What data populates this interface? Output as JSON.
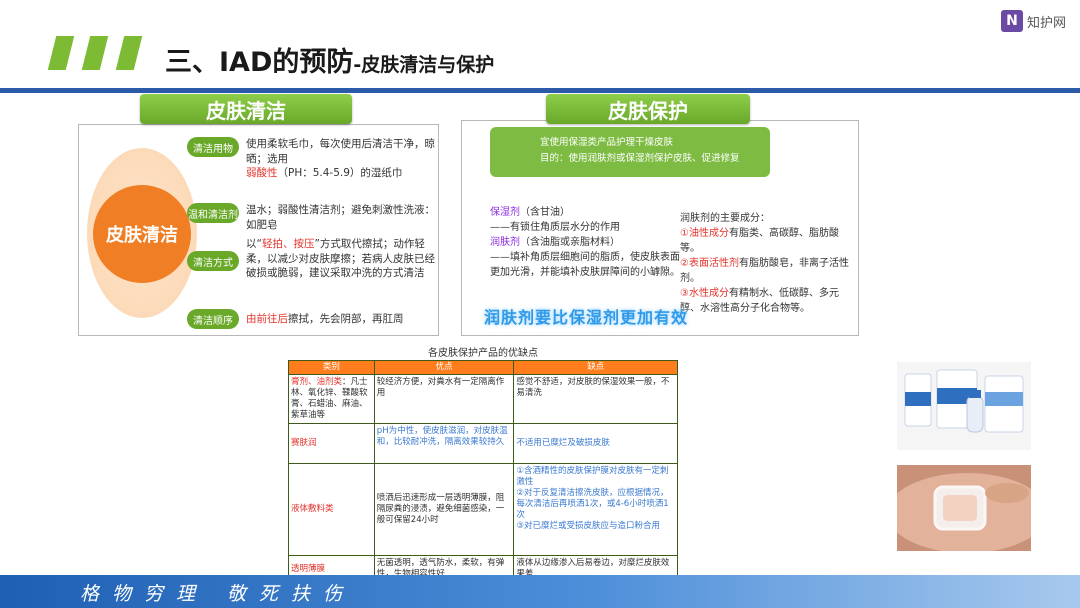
{
  "header": {
    "title_main": "三、IAD的预防",
    "title_sub": "-皮肤清洁与保护",
    "watermark_text": "知护网",
    "watermark_logo": "N"
  },
  "cleaning": {
    "tag": "皮肤清洁",
    "center": "皮肤清洁",
    "rows": [
      {
        "pill": "清洁用物",
        "text": "使用柔软毛巾，每次使用后清洁干净，晾晒；选用",
        "text_red": "弱酸性",
        "text_tail": "（PH：5.4-5.9）的湿纸巾"
      },
      {
        "pill": "温和清洁剂",
        "text": "温水；弱酸性清洁剂；避免刺激性洗液：如肥皂"
      },
      {
        "pill": "清洁方式",
        "text_pre": "以“",
        "text_red": "轻拍、按压",
        "text": "”方式取代擦拭；动作轻柔，以减少对皮肤摩擦；若病人皮肤已经破损或脆弱，建议采取冲洗的方式清洁"
      },
      {
        "pill": "清洁顺序",
        "text_red": "由前往后",
        "text": "擦拭，先会阴部，再肛周"
      }
    ]
  },
  "protection": {
    "tag": "皮肤保护",
    "goal_line1": "宜使用保湿类产品护理干燥皮肤",
    "goal_line2": "目的：使用润肤剂或保湿剂保护皮肤、促进修复",
    "moisturizer_label": "保湿剂",
    "moisturizer_note": "（含甘油）",
    "moisturizer_desc": "——有锁住角质层水分的作用",
    "emollient_label": "润肤剂",
    "emollient_note": "（含油脂或亲脂材料）",
    "emollient_desc": "——填补角质层细胞间的脂质，使皮肤表面更加光滑，并能填补皮肤屏障间的小罅隙。",
    "components_title": "润肤剂的主要成分：",
    "components": [
      {
        "num": "①",
        "red": "油性成分",
        "text": "有脂类、高碳醇、脂肪酸等。"
      },
      {
        "num": "②",
        "red": "表面活性剂",
        "text": "有脂肪酸皂，非离子活性剂。"
      },
      {
        "num": "③",
        "red": "水性成分",
        "text": "有精制水、低碳醇、多元醇、水溶性高分子化合物等。"
      }
    ],
    "slogan": "润肤剂要比保湿剂更加有效"
  },
  "table": {
    "title": "各皮肤保护产品的优缺点",
    "headers": [
      "类别",
      "优点",
      "缺点"
    ],
    "rows": [
      {
        "type": "膏剂、油剂类",
        "type_tail": "：凡士林、氧化锌、鞣酸软膏、石蜡油、麻油、紫草油等",
        "pros": "较经济方便，对粪水有一定隔离作用",
        "cons": "感觉不舒适，对皮肤的保湿效果一般，不易清洗"
      },
      {
        "type": "赛肤润",
        "pros": "pH为中性，使皮肤滋润，对皮肤温和，比较耐冲洗，隔离效果较持久",
        "cons": "不适用已糜烂及破损皮肤"
      },
      {
        "type": "液体敷料类",
        "pros": "喷洒后迅速形成一层透明薄膜，阻隔尿粪的浸渍，避免细菌感染，一般可保留24小时",
        "cons": "①含酒精性的皮肤保护膜对皮肤有一定刺激性\n②对于反复清洁擦洗皮肤，应根据情况，每次清洁后再喷洒1次，或4-6小时喷洒1次\n③对已糜烂或受损皮肤应与造口粉合用"
      },
      {
        "type": "透明薄膜",
        "pros": "无菌透明，透气防水，柔软，有弹性，生物相容性好",
        "cons": "液体从边缘渗入后易卷边，对糜烂皮肤效果差"
      }
    ]
  },
  "footer": {
    "motto": "格物穷理 敬死扶伤"
  },
  "colors": {
    "accent_green": "#7dbb34",
    "header_blue": "#2b5ba8",
    "table_header": "#ff7d1c",
    "highlight_red": "#e3322b"
  }
}
